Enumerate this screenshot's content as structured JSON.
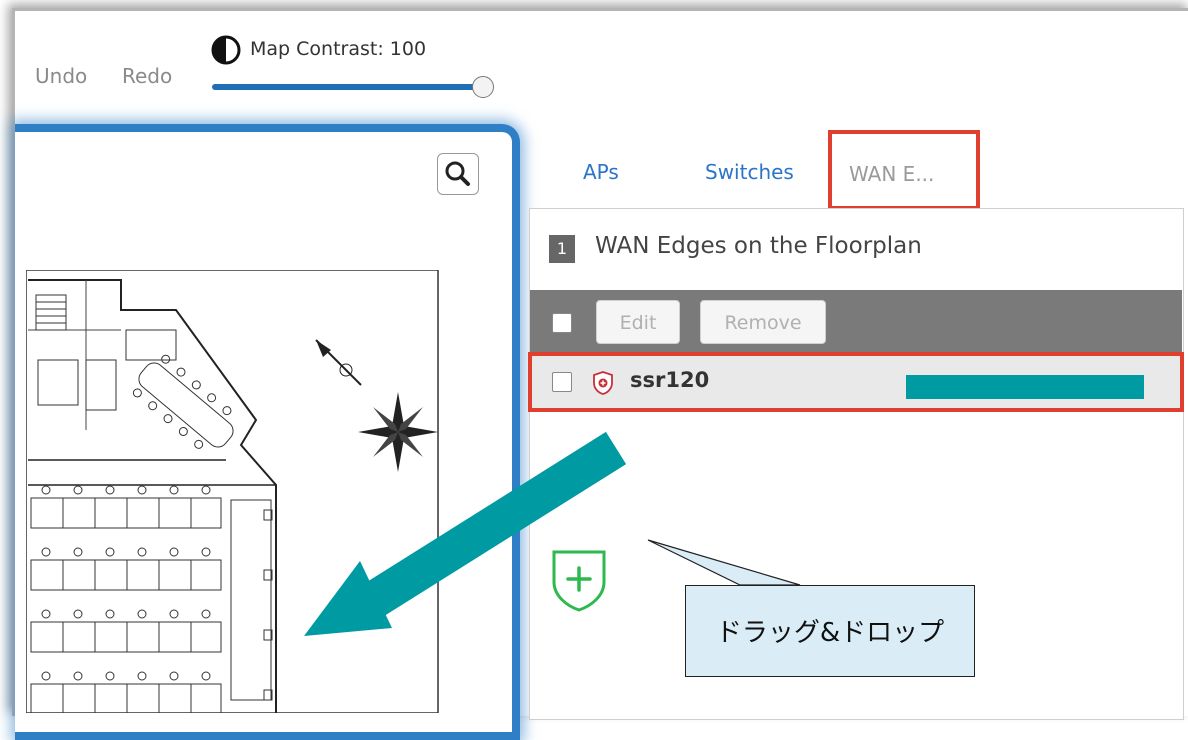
{
  "toolbar": {
    "undo_label": "Undo",
    "redo_label": "Redo",
    "map_contrast_label": "Map Contrast: 100",
    "map_contrast_value": 100
  },
  "tabs": [
    {
      "label": "APs"
    },
    {
      "label": "Switches"
    },
    {
      "label": "WAN E..."
    }
  ],
  "list": {
    "count": "1",
    "title": "WAN Edges on the Floorplan",
    "edit_label": "Edit",
    "remove_label": "Remove",
    "items": [
      {
        "name": "ssr120"
      }
    ]
  },
  "annotation": {
    "callout_text": "ドラッグ&ドロップ"
  },
  "colors": {
    "accent_blue": "#2f7fc7",
    "highlight_red": "#e03e2e",
    "teal": "#009aa3",
    "add_green": "#2eb84e",
    "device_icon_red": "#c8303a"
  }
}
